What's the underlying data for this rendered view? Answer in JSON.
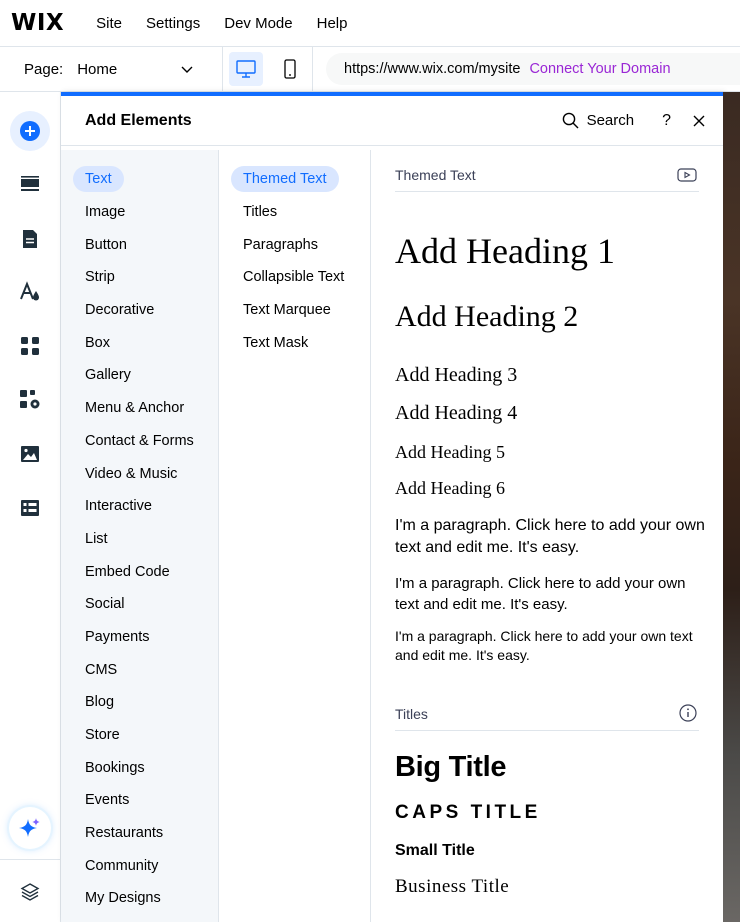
{
  "topbar": {
    "logo": "WIX",
    "menu": [
      "Site",
      "Settings",
      "Dev Mode",
      "Help"
    ]
  },
  "subbar": {
    "page_label": "Page:",
    "page_value": "Home",
    "url": "https://www.wix.com/mysite",
    "connect_domain": "Connect Your Domain"
  },
  "panel": {
    "title": "Add Elements",
    "search_label": "Search",
    "help_label": "?",
    "categories": [
      "Text",
      "Image",
      "Button",
      "Strip",
      "Decorative",
      "Box",
      "Gallery",
      "Menu & Anchor",
      "Contact & Forms",
      "Video & Music",
      "Interactive",
      "List",
      "Embed Code",
      "Social",
      "Payments",
      "CMS",
      "Blog",
      "Store",
      "Bookings",
      "Events",
      "Restaurants",
      "Community",
      "My Designs"
    ],
    "active_category": "Text",
    "subcategories": [
      "Themed Text",
      "Titles",
      "Paragraphs",
      "Collapsible Text",
      "Text Marquee",
      "Text Mask"
    ],
    "active_subcategory": "Themed Text",
    "themed_text": {
      "heading": "Themed Text",
      "h1": "Add Heading 1",
      "h2": "Add Heading 2",
      "h3": "Add Heading 3",
      "h4": "Add Heading 4",
      "h5": "Add Heading 5",
      "h6": "Add Heading 6",
      "p1": "I'm a paragraph. Click here to add your own text and edit me. It's easy.",
      "p2": "I'm a paragraph. Click here to add your own text and edit me. It's easy.",
      "p3": "I'm a paragraph. Click here to add your own text and edit me. It's easy."
    },
    "titles": {
      "heading": "Titles",
      "big": "Big Title",
      "caps": "CAPS TITLE",
      "small": "Small Title",
      "business": "Business Title"
    }
  },
  "colors": {
    "accent": "#116dff",
    "accent_bg": "#d9e6ff",
    "connect": "#9a27d5"
  }
}
